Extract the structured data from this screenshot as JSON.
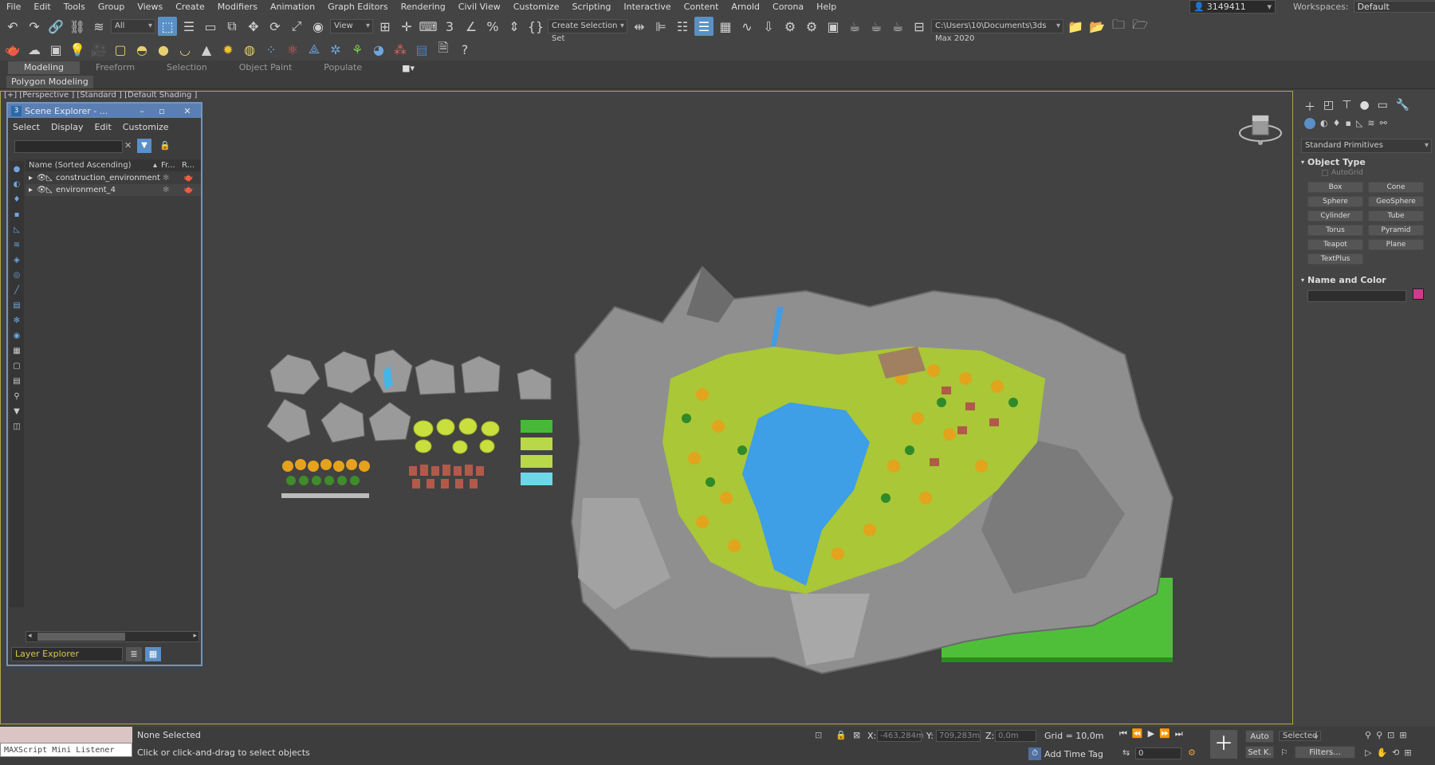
{
  "menubar": {
    "items": [
      "File",
      "Edit",
      "Tools",
      "Group",
      "Views",
      "Create",
      "Modifiers",
      "Animation",
      "Graph Editors",
      "Rendering",
      "Civil View",
      "Customize",
      "Scripting",
      "Interactive",
      "Content",
      "Arnold",
      "Corona",
      "Help"
    ]
  },
  "user": {
    "name": "3149411"
  },
  "workspaces": {
    "label": "Workspaces:",
    "value": "Default"
  },
  "toolbar": {
    "selection_filter": "All",
    "ref_coord": "View",
    "selection_set": "Create Selection Set",
    "project_path": "C:\\Users\\10\\Documents\\3ds Max 2020"
  },
  "ribbon": {
    "tabs": [
      "Modeling",
      "Freeform",
      "Selection",
      "Object Paint",
      "Populate"
    ],
    "sub_label": "Polygon Modeling"
  },
  "viewport": {
    "label": "[+] [Perspective ] [Standard ] [Default Shading ]"
  },
  "scene_explorer": {
    "title": "Scene Explorer - ...",
    "menu": [
      "Select",
      "Display",
      "Edit",
      "Customize"
    ],
    "col_name": "Name (Sorted Ascending)",
    "col_fr": "Fr...",
    "col_r": "R...",
    "rows": [
      {
        "name": "construction_environment"
      },
      {
        "name": "environment_4"
      }
    ],
    "layer_explorer": "Layer Explorer"
  },
  "command_panel": {
    "category": "Standard Primitives",
    "object_type_title": "Object Type",
    "autogrid": "AutoGrid",
    "buttons": [
      "Box",
      "Cone",
      "Sphere",
      "GeoSphere",
      "Cylinder",
      "Tube",
      "Torus",
      "Pyramid",
      "Teapot",
      "Plane",
      "TextPlus"
    ],
    "name_color_title": "Name and Color",
    "object_color": "#d13a8a"
  },
  "status": {
    "listener": "MAXScript Mini Listener",
    "selected": "None Selected",
    "prompt": "Click or click-and-drag to select objects",
    "x_label": "X:",
    "x_value": "-463,284m",
    "y_label": "Y:",
    "y_value": "709,283m",
    "z_label": "Z:",
    "z_value": "0,0m",
    "grid": "Grid = 10,0m",
    "add_time_tag": "Add Time Tag",
    "auto": "Auto",
    "set_key": "Set K.",
    "key_filter": "Selected",
    "filters": "Filters...",
    "frame": "0"
  },
  "colors": {
    "accent": "#5b8fc7",
    "viewport_border": "#b8a24a",
    "layer_text": "#d8c94a"
  }
}
